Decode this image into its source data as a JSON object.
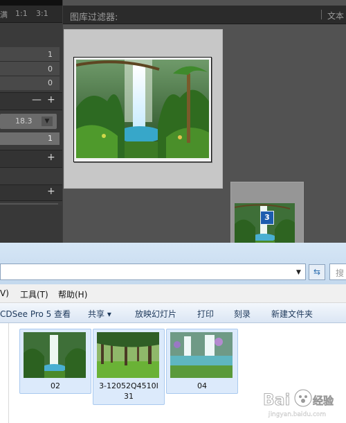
{
  "lightroom": {
    "left_panel": {
      "header_text": "满",
      "ratio_1": "1:1",
      "ratio_2": "3:1",
      "counts": [
        "1",
        "0",
        "0"
      ],
      "dropdown_value": "18.3",
      "selected_count": "1"
    },
    "filter_bar": {
      "title": "图库过滤器:",
      "text_label": "文本"
    },
    "drag_badge": "3"
  },
  "explorer": {
    "search_placeholder": "搜",
    "menu": [
      "V)",
      "工具(T)",
      "帮助(H)"
    ],
    "toolbar": [
      "CDSee Pro 5 查看",
      "共享 ▾",
      "放映幻灯片",
      "打印",
      "刻录",
      "新建文件夹"
    ],
    "files": [
      {
        "name": "02"
      },
      {
        "name": "3-12052Q4510I\n31"
      },
      {
        "name": "04"
      }
    ]
  },
  "watermark": {
    "brand": "Bai",
    "brand_suffix": "经验",
    "url": "jingyan.baidu.com"
  },
  "colors": {
    "accent": "#1d5cae",
    "selection": "#dceafb"
  }
}
